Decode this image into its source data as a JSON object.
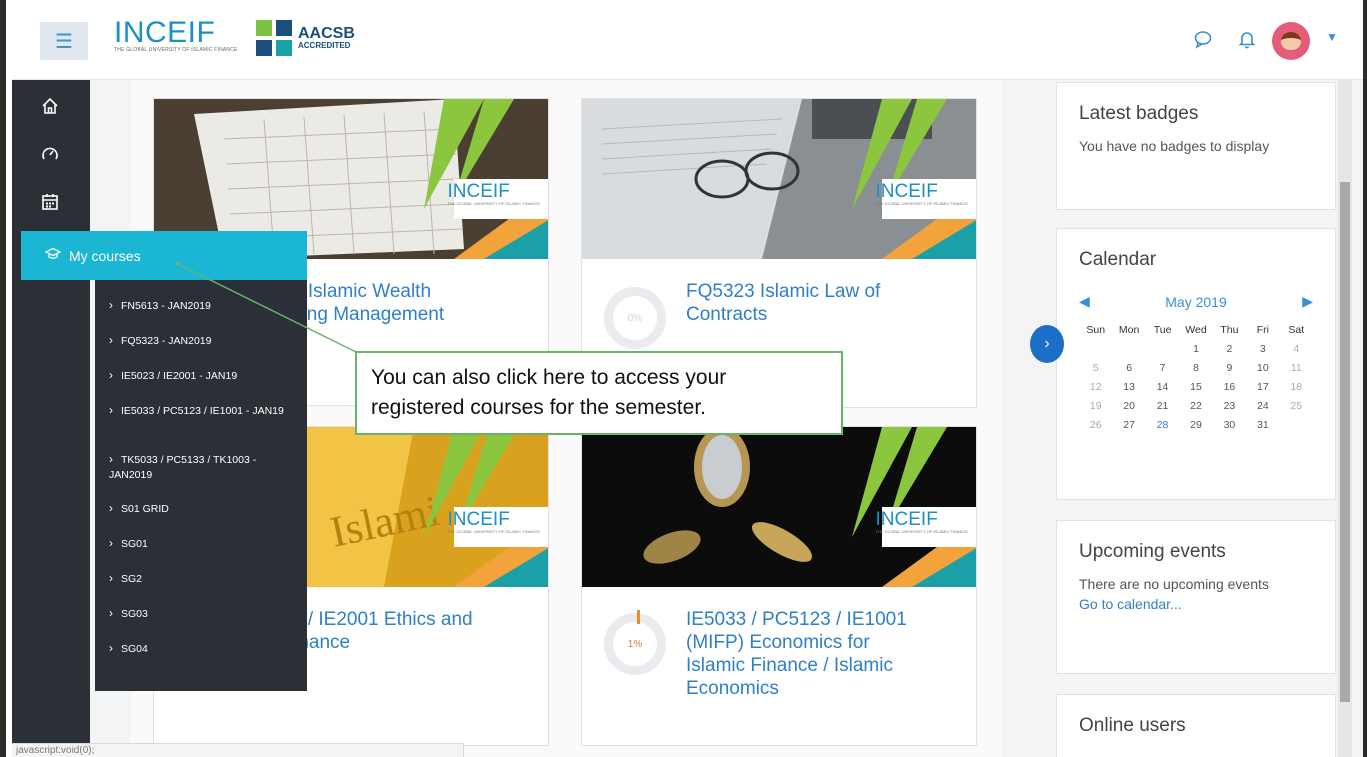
{
  "header": {
    "logo_text": "INCEIF",
    "logo_tagline": "THE GLOBAL UNIVERSITY OF ISLAMIC FINANCE",
    "aacsb_line1": "AACSB",
    "aacsb_line2": "ACCREDITED"
  },
  "nav": {
    "my_courses_label": "My courses",
    "courses": [
      "FN5613 - JAN2019",
      "FQ5323 - JAN2019",
      "IE5023 / IE2001 - JAN19",
      "IE5033 / PC5123 / IE1001 - JAN19",
      "TK5033 / PC5133 / TK1003 - JAN2019",
      "S01 GRID",
      "SG01",
      "SG2",
      "SG03",
      "SG04"
    ]
  },
  "callout": {
    "text_line1": "You can also click here to access your",
    "text_line2": "registered courses for the semester."
  },
  "cards": [
    {
      "title_line1": "3 Islamic Wealth",
      "title_line2": "ning Management",
      "badge": "INCEIF"
    },
    {
      "title_line1": "FQ5323 Islamic Law of",
      "title_line2": "Contracts",
      "progress": "0%",
      "badge": "INCEIF"
    },
    {
      "title_line1": "3 / IE2001 Ethics and",
      "title_line2": "rnance",
      "badge": "INCEIF"
    },
    {
      "title_line1": "IE5033 / PC5123 / IE1001",
      "title_line2": "(MIFP) Economics for",
      "title_line3": "Islamic Finance / Islamic",
      "title_line4": "Economics",
      "progress": "1%",
      "badge": "INCEIF"
    }
  ],
  "blocks": {
    "badges": {
      "title": "Latest badges",
      "text": "You have no badges to display"
    },
    "calendar": {
      "title": "Calendar",
      "month": "May 2019",
      "day_names": [
        "Sun",
        "Mon",
        "Tue",
        "Wed",
        "Thu",
        "Fri",
        "Sat"
      ],
      "weeks": [
        [
          "",
          "",
          "",
          "1",
          "2",
          "3",
          "4"
        ],
        [
          "5",
          "6",
          "7",
          "8",
          "9",
          "10",
          "11"
        ],
        [
          "12",
          "13",
          "14",
          "15",
          "16",
          "17",
          "18"
        ],
        [
          "19",
          "20",
          "21",
          "22",
          "23",
          "24",
          "25"
        ],
        [
          "26",
          "27",
          "28",
          "29",
          "30",
          "31",
          ""
        ]
      ],
      "today": "28"
    },
    "events": {
      "title": "Upcoming events",
      "text": "There are no upcoming events",
      "link": "Go to calendar..."
    },
    "online": {
      "title": "Online users"
    }
  },
  "statusbar": {
    "text": "javascript:void(0);"
  },
  "colors": {
    "accent": "#1ab6d3",
    "link": "#2f7fc7",
    "rail": "#2b2f36",
    "callout_border": "#6bb36b"
  }
}
